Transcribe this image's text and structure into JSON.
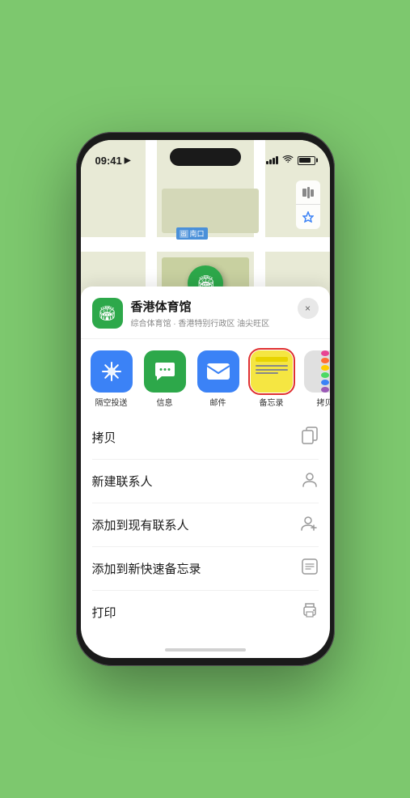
{
  "status_bar": {
    "time": "09:41",
    "location_arrow": "▶"
  },
  "map": {
    "label_prefix": "南口",
    "label_tag": "出",
    "pin_label": "香港体育馆"
  },
  "venue": {
    "name": "香港体育馆",
    "description": "综合体育馆 · 香港特别行政区 油尖旺区",
    "close_label": "×"
  },
  "share_items": [
    {
      "id": "airdrop",
      "label": "隔空投送",
      "bg": "airdrop",
      "icon": "📡"
    },
    {
      "id": "messages",
      "label": "信息",
      "bg": "messages",
      "icon": "💬"
    },
    {
      "id": "mail",
      "label": "邮件",
      "bg": "mail",
      "icon": "✉️"
    },
    {
      "id": "notes",
      "label": "备忘录",
      "bg": "notes",
      "icon": "notes",
      "selected": true
    },
    {
      "id": "more",
      "label": "拷贝",
      "bg": "more",
      "icon": "more"
    }
  ],
  "actions": [
    {
      "id": "copy",
      "label": "拷贝",
      "icon": "copy"
    },
    {
      "id": "new-contact",
      "label": "新建联系人",
      "icon": "person"
    },
    {
      "id": "add-existing",
      "label": "添加到现有联系人",
      "icon": "person-add"
    },
    {
      "id": "add-note",
      "label": "添加到新快速备忘录",
      "icon": "note"
    },
    {
      "id": "print",
      "label": "打印",
      "icon": "print"
    }
  ]
}
